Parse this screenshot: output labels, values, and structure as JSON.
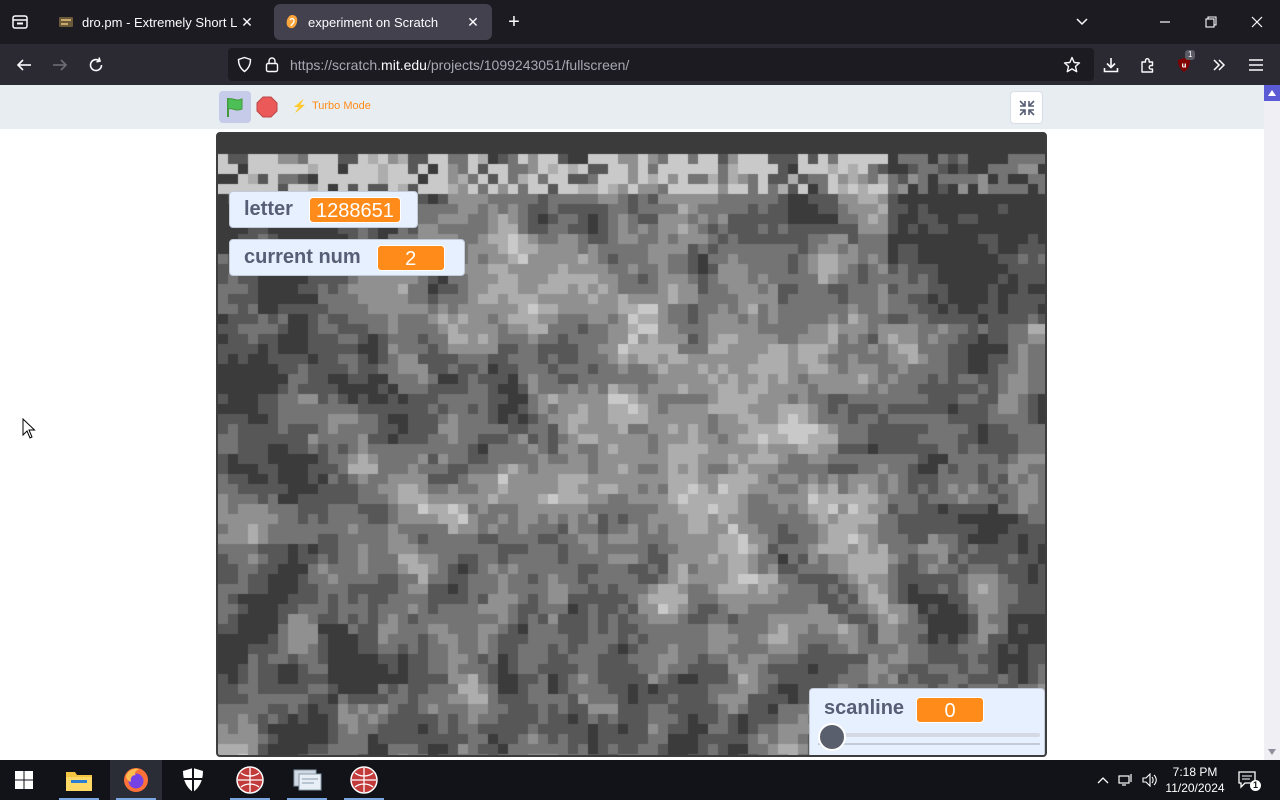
{
  "browser": {
    "tabs": [
      {
        "title": "dro.pm - Extremely Short Links",
        "active": false,
        "favicon": "dropm-favicon"
      },
      {
        "title": "experiment on Scratch",
        "active": true,
        "favicon": "scratch-favicon"
      }
    ],
    "url": {
      "prefix": "https://scratch.",
      "host": "mit.edu",
      "path": "/projects/1099243051/fullscreen/"
    },
    "extension_badge": "1"
  },
  "scratch": {
    "turbo_label": "Turbo Mode",
    "monitors": {
      "letter": {
        "label": "letter",
        "value": "1288651"
      },
      "current_num": {
        "label": "current num",
        "value": "2"
      },
      "scanline": {
        "label": "scanline",
        "value": "0",
        "slider": 0
      }
    }
  },
  "taskbar": {
    "time": "7:18 PM",
    "date": "11/20/2024",
    "notification_count": "1"
  },
  "colors": {
    "scratch_orange": "#ff8c1a",
    "monitor_bg": "#e6f0ff",
    "flag_green": "#4cbf56",
    "stop_red": "#ec5959"
  }
}
